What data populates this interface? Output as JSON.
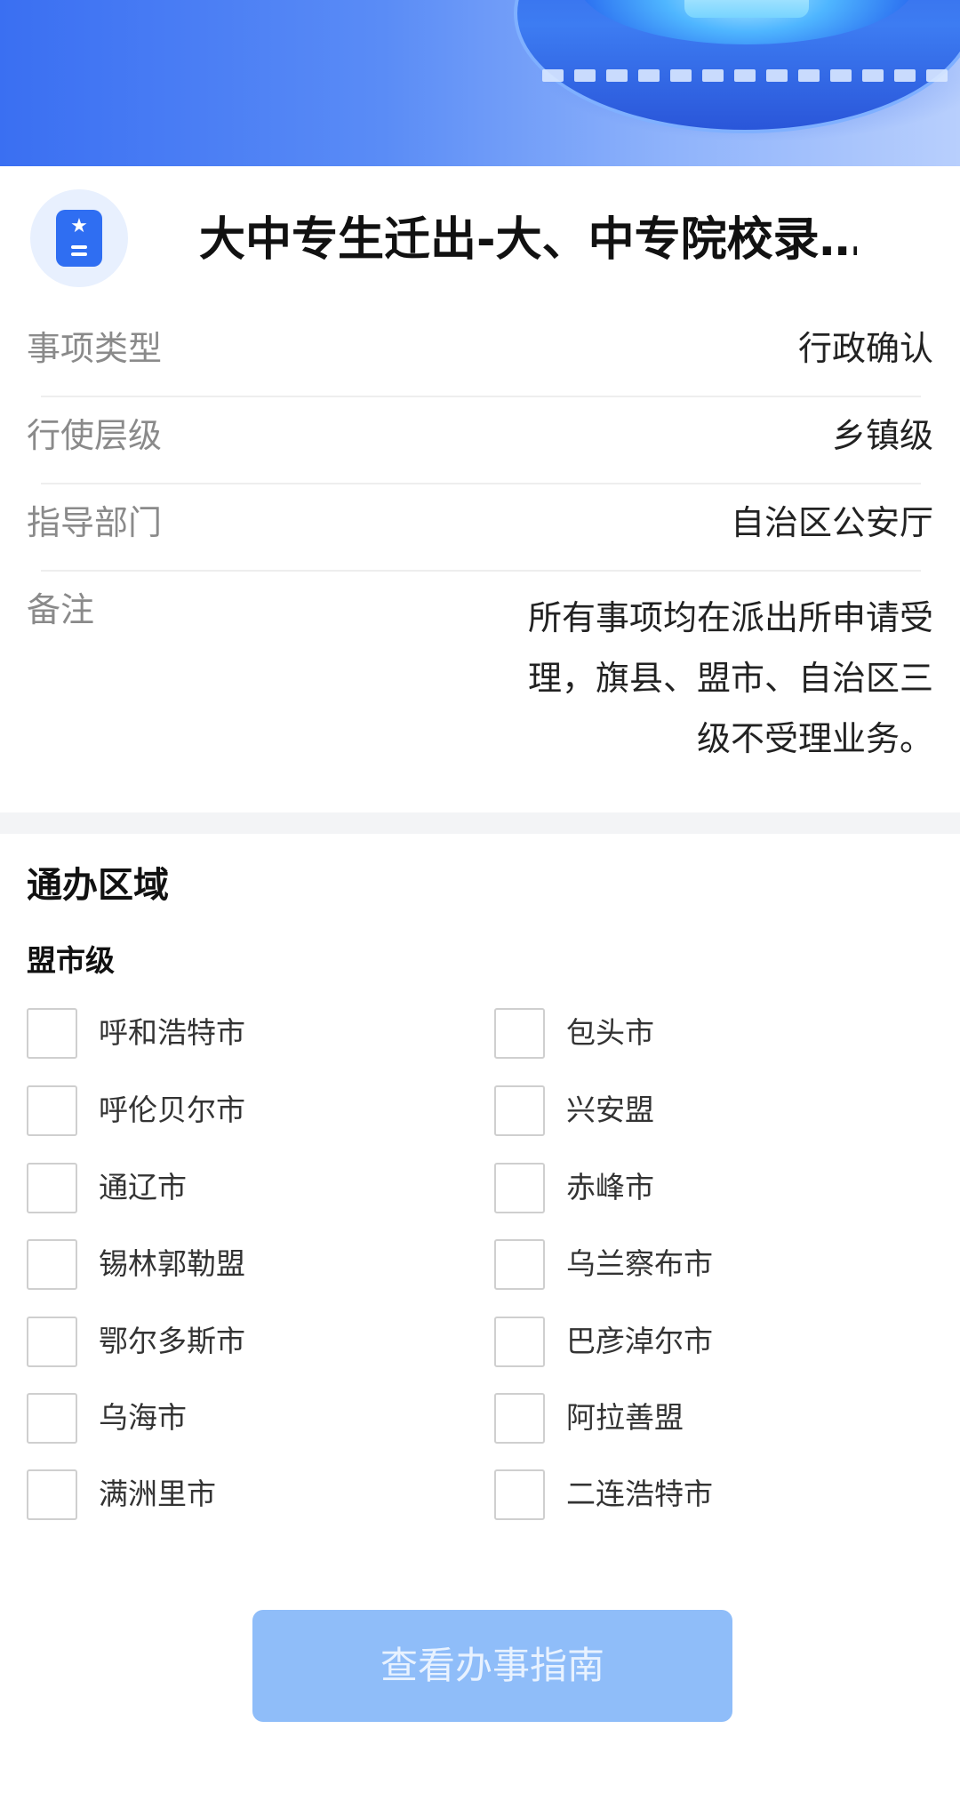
{
  "header": {
    "title": "大中专生迁出-大、中专院校录…",
    "icon": "star-badge-icon"
  },
  "info_rows": [
    {
      "label": "事项类型",
      "value": "行政确认"
    },
    {
      "label": "行使层级",
      "value": "乡镇级"
    },
    {
      "label": "指导部门",
      "value": "自治区公安厅"
    }
  ],
  "note": {
    "label": "备注",
    "lines": [
      "所有事项均在派出所申请受",
      "理，旗县、盟市、自治区三",
      "级不受理业务。"
    ]
  },
  "region": {
    "title": "通办区域",
    "level": "盟市级",
    "items": [
      "呼和浩特市",
      "包头市",
      "呼伦贝尔市",
      "兴安盟",
      "通辽市",
      "赤峰市",
      "锡林郭勒盟",
      "乌兰察布市",
      "鄂尔多斯市",
      "巴彦淖尔市",
      "乌海市",
      "阿拉善盟",
      "满洲里市",
      "二连浩特市"
    ]
  },
  "actions": {
    "guide_label": "查看办事指南"
  },
  "colors": {
    "accent": "#2f6ef2",
    "button_disabled": "#8fbdf9",
    "label_gray": "#8a8a8a"
  }
}
